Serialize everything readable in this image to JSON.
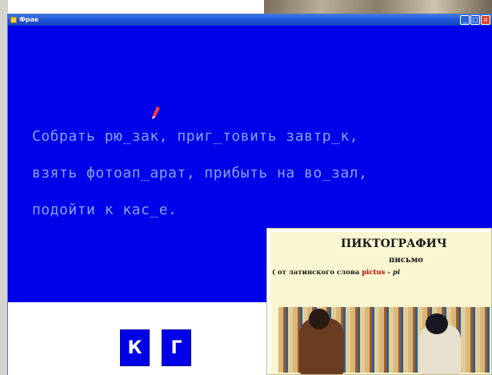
{
  "window": {
    "title": "Фрак",
    "buttons": {
      "minimize": "_",
      "maximize": "□",
      "close": "×"
    }
  },
  "exercise": {
    "lines": [
      "Собрать рю_зак, приг_товить завтр_к,",
      "взять фотоап_арат, прибыть на во_зал,",
      "подойти к кас_е."
    ]
  },
  "answers": [
    "К",
    "Г"
  ],
  "slide": {
    "title": "ПИКТОГРАФИЧ",
    "subtitle": "письмо",
    "origin_prefix": "( от латинского слова ",
    "origin_word": "pictus",
    "origin_suffix": " - pi"
  },
  "colors": {
    "window_bg": "#0000e8",
    "text": "#8aa0ff",
    "slide_bg": "#fbf6d2"
  },
  "icons": {
    "pen": "pen-icon"
  }
}
